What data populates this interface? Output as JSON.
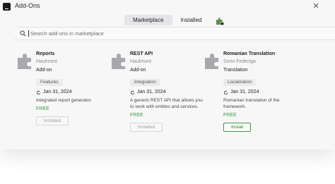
{
  "window": {
    "title": "Add-Ons",
    "close_icon": "close-icon",
    "app_icon": "intellij-icon"
  },
  "tabs": [
    {
      "label": "Marketplace",
      "active": true
    },
    {
      "label": "Installed",
      "active": false
    }
  ],
  "tab_icon": "puzzle-settings-icon",
  "search": {
    "placeholder": "Search add-ons in marketplace",
    "icon": "search-icon"
  },
  "colors": {
    "free": "#3c9a3c",
    "puzzle": "#a7a9ad",
    "window_bg": "#f7f7f8"
  },
  "addons": [
    {
      "name": "Reports",
      "vendor": "Haulmont",
      "kind": "Add-on",
      "tag": "Features",
      "date": "Jan 31, 2024",
      "description": "Integrated report generator.",
      "price": "FREE",
      "button": "Installed",
      "button_state": "installed"
    },
    {
      "name": "REST API",
      "vendor": "Haulmont",
      "kind": "Add-on",
      "tag": "Integration",
      "date": "Jan 31, 2024",
      "description": "A generic REST API that allows you to work with entities and services.",
      "price": "FREE",
      "button": "Installed",
      "button_state": "installed"
    },
    {
      "name": "Romanian Translation",
      "vendor": "Sorin Federiga",
      "kind": "Translation",
      "tag": "Localization",
      "date": "Jan 31, 2024",
      "description": "Romanian translation of the framework.",
      "price": "FREE",
      "button": "Install",
      "button_state": "install"
    }
  ]
}
